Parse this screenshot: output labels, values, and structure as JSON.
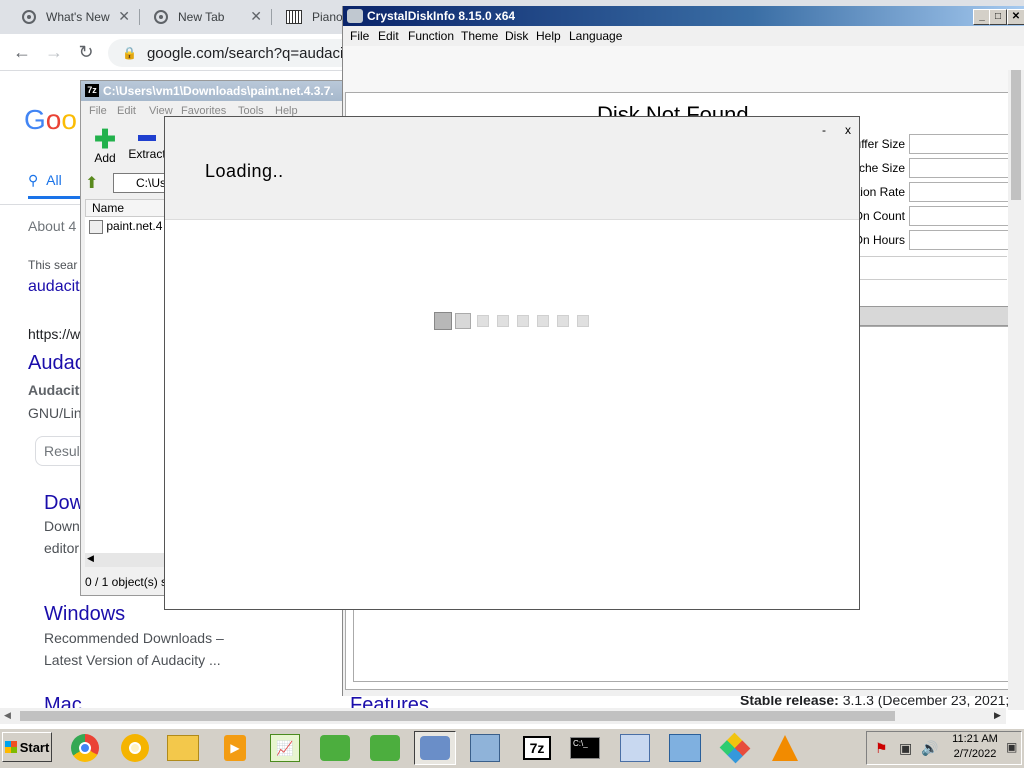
{
  "chrome": {
    "tabs": [
      {
        "label": "What's New"
      },
      {
        "label": "New Tab"
      },
      {
        "label": "Piano"
      }
    ],
    "omnibox": "google.com/search?q=audacity&",
    "page": {
      "logo": "Goo",
      "tab_all": "All",
      "about": "About 4",
      "snippet1": "This sear",
      "link1": "audacit",
      "url2": "https://w",
      "link2": "Audac",
      "bold2": "Audacity",
      "text2": "GNU/Lin",
      "result_chip": "Result",
      "link3": "Dow",
      "text3a": "Down",
      "text3b": "editor",
      "link4": "Windows",
      "text4a": "Recommended Downloads –",
      "text4b": "Latest Version of Audacity ...",
      "link5": "Mac",
      "features": "Features",
      "stable_label": "Stable release:",
      "stable_value": "3.1.3 (December 23, 2021;"
    }
  },
  "sevenzip": {
    "title": "C:\\Users\\vm1\\Downloads\\paint.net.4.3.7.",
    "menu": [
      "File",
      "Edit",
      "View",
      "Favorites",
      "Tools",
      "Help"
    ],
    "toolbar": {
      "add": "Add",
      "extract": "Extract"
    },
    "path": "C:\\Us",
    "column_name": "Name",
    "file": "paint.net.4",
    "status": "0 / 1 object(s) s"
  },
  "cdi": {
    "title": "CrystalDiskInfo 8.15.0 x64",
    "menu": [
      "File",
      "Edit",
      "Function",
      "Theme",
      "Disk",
      "Help",
      "Language"
    ],
    "disk_not_found": "Disk Not Found",
    "fields": [
      "uffer Size",
      "ache Size",
      "tion Rate",
      "On Count",
      "On Hours"
    ]
  },
  "loading_dialog": {
    "text": "Loading..",
    "minimize": "-",
    "close": "x"
  },
  "taskbar": {
    "start": "Start",
    "time": "11:21 AM",
    "date": "2/7/2022"
  }
}
